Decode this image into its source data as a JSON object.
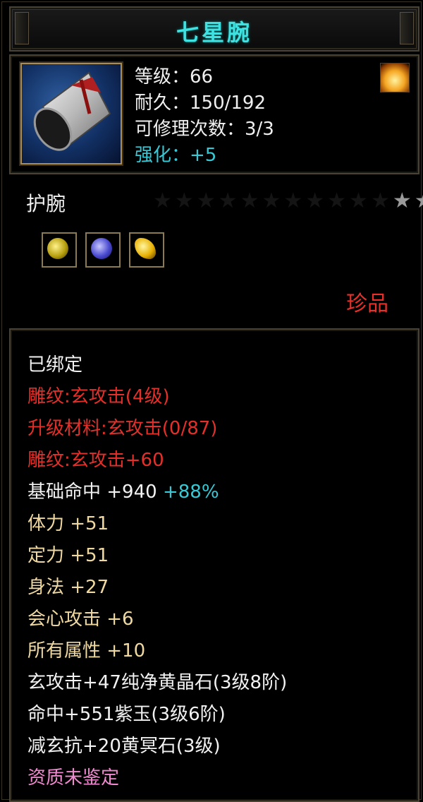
{
  "title": "七星腕",
  "header": {
    "level": "等级：66",
    "durability": "耐久：150/192",
    "repair": "可修理次数：3/3",
    "enhance": "强化：+5"
  },
  "subtype": "护腕",
  "stars": {
    "empty": "★★★★★★★★★★★",
    "filled": "★★"
  },
  "rarity": "珍品",
  "attributes": {
    "bound": "已绑定",
    "engrave": "雕纹:玄攻击(4级)",
    "upgrade_material": "升级材料:玄攻击(0/87)",
    "engrave_bonus": "雕纹:玄攻击+60",
    "base_hit": "基础命中 +940",
    "base_hit_pct": "+88%",
    "stamina": "体力 +51",
    "focus": "定力 +51",
    "agility": "身法 +27",
    "crit": "会心攻击 +6",
    "all_attr": "所有属性 +10",
    "socket1": "玄攻击+47纯净黄晶石(3级8阶)",
    "socket2": "命中+551紫玉(3级6阶)",
    "socket3": "减玄抗+20黄冥石(3级)",
    "quality": "资质未鉴定"
  },
  "colors": {
    "title": "#3fe2e0",
    "enhance": "#37c9d6",
    "red": "#e3302a",
    "gold": "#f0d9a0",
    "pink": "#f08ad0",
    "border": "#4a4334"
  },
  "icons": [
    "bracer-icon",
    "flame-icon",
    "yellow-gem-icon",
    "blue-gem-icon",
    "gold-gem-icon"
  ]
}
